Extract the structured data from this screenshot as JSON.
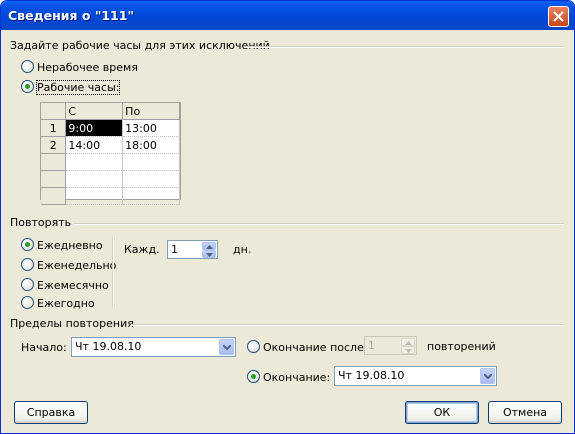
{
  "window": {
    "title": "Сведения о \"111\""
  },
  "work_hours": {
    "group_label": "Задайте рабочие часы для этих исключений",
    "options": [
      "Нерабочее время",
      "Рабочие часы:"
    ],
    "selected": "Рабочие часы:",
    "table": {
      "headers": [
        "С",
        "По"
      ],
      "rows": [
        {
          "num": "1",
          "from": "9:00",
          "to": "13:00"
        },
        {
          "num": "2",
          "from": "14:00",
          "to": "18:00"
        },
        {
          "num": "",
          "from": "",
          "to": ""
        },
        {
          "num": "",
          "from": "",
          "to": ""
        },
        {
          "num": "",
          "from": "",
          "to": ""
        }
      ]
    }
  },
  "repeat": {
    "group_label": "Повторять",
    "options": [
      "Ежедневно",
      "Еженедельно",
      "Ежемесячно",
      "Ежегодно"
    ],
    "selected": "Ежедневно",
    "every_label": "Кажд.",
    "every_value": "1",
    "unit": "дн."
  },
  "range": {
    "group_label": "Пределы повторения",
    "start_label": "Начало:",
    "start_value": "Чт 19.08.10",
    "end_after_label": "Окончание после",
    "end_after_value": "1",
    "occurrences_label": "повторений",
    "end_by_label": "Окончание:",
    "end_by_value": "Чт 19.08.10",
    "selected": "Окончание:"
  },
  "buttons": {
    "help": "Справка",
    "ok": "ОК",
    "cancel": "Отмена"
  },
  "colors": {
    "titlebar": "#0054e3",
    "dialog_bg": "#ece9d8",
    "radio_dot": "#21a121",
    "close_button": "#c8461f"
  }
}
